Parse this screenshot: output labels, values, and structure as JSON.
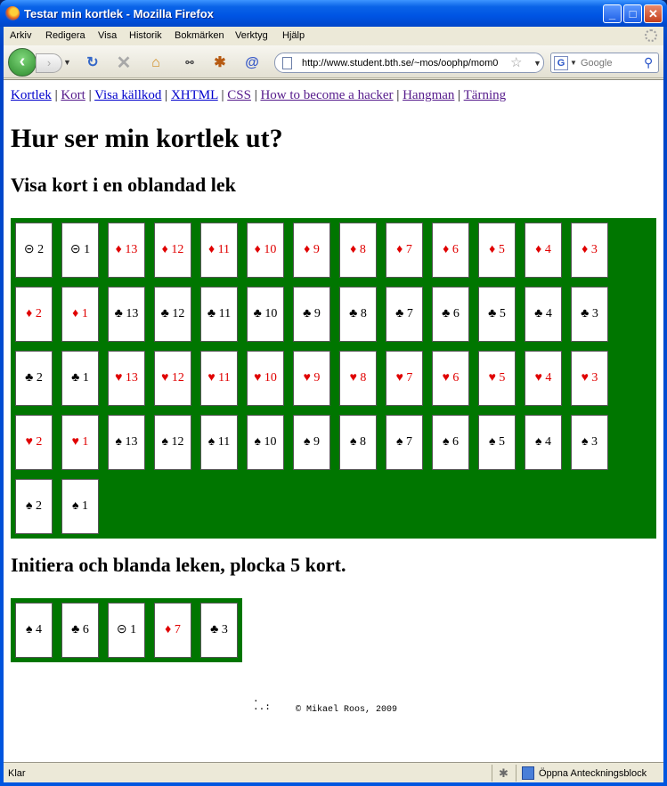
{
  "window": {
    "title": "Testar min kortlek - Mozilla Firefox"
  },
  "menubar": {
    "items": [
      "Arkiv",
      "Redigera",
      "Visa",
      "Historik",
      "Bokmärken",
      "Verktyg",
      "Hjälp"
    ]
  },
  "navbar": {
    "url": "http://www.student.bth.se/~mos/oophp/mom0",
    "search_placeholder": "Google",
    "search_engine_letter": "G"
  },
  "page": {
    "top_links": [
      "Kortlek",
      "Kort",
      "Visa källkod",
      "XHTML",
      "CSS",
      "How to become a hacker",
      "Hangman",
      "Tärning"
    ],
    "link_separator": "|",
    "heading": "Hur ser min kortlek ut?",
    "section1_heading": "Visa kort i en oblandad lek",
    "section2_heading": "Initiera och blanda leken, plocka 5 kort.",
    "colors": {
      "table_green": "#007600",
      "red_suit": "#e00000",
      "black_suit": "#000000"
    },
    "unshuffled_cards": [
      {
        "suit": "⊝",
        "value": "2",
        "color": "black"
      },
      {
        "suit": "⊝",
        "value": "1",
        "color": "black"
      },
      {
        "suit": "♦",
        "value": "13",
        "color": "red"
      },
      {
        "suit": "♦",
        "value": "12",
        "color": "red"
      },
      {
        "suit": "♦",
        "value": "11",
        "color": "red"
      },
      {
        "suit": "♦",
        "value": "10",
        "color": "red"
      },
      {
        "suit": "♦",
        "value": "9",
        "color": "red"
      },
      {
        "suit": "♦",
        "value": "8",
        "color": "red"
      },
      {
        "suit": "♦",
        "value": "7",
        "color": "red"
      },
      {
        "suit": "♦",
        "value": "6",
        "color": "red"
      },
      {
        "suit": "♦",
        "value": "5",
        "color": "red"
      },
      {
        "suit": "♦",
        "value": "4",
        "color": "red"
      },
      {
        "suit": "♦",
        "value": "3",
        "color": "red"
      },
      {
        "suit": "♦",
        "value": "2",
        "color": "red"
      },
      {
        "suit": "♦",
        "value": "1",
        "color": "red"
      },
      {
        "suit": "♣",
        "value": "13",
        "color": "black"
      },
      {
        "suit": "♣",
        "value": "12",
        "color": "black"
      },
      {
        "suit": "♣",
        "value": "11",
        "color": "black"
      },
      {
        "suit": "♣",
        "value": "10",
        "color": "black"
      },
      {
        "suit": "♣",
        "value": "9",
        "color": "black"
      },
      {
        "suit": "♣",
        "value": "8",
        "color": "black"
      },
      {
        "suit": "♣",
        "value": "7",
        "color": "black"
      },
      {
        "suit": "♣",
        "value": "6",
        "color": "black"
      },
      {
        "suit": "♣",
        "value": "5",
        "color": "black"
      },
      {
        "suit": "♣",
        "value": "4",
        "color": "black"
      },
      {
        "suit": "♣",
        "value": "3",
        "color": "black"
      },
      {
        "suit": "♣",
        "value": "2",
        "color": "black"
      },
      {
        "suit": "♣",
        "value": "1",
        "color": "black"
      },
      {
        "suit": "♥",
        "value": "13",
        "color": "red"
      },
      {
        "suit": "♥",
        "value": "12",
        "color": "red"
      },
      {
        "suit": "♥",
        "value": "11",
        "color": "red"
      },
      {
        "suit": "♥",
        "value": "10",
        "color": "red"
      },
      {
        "suit": "♥",
        "value": "9",
        "color": "red"
      },
      {
        "suit": "♥",
        "value": "8",
        "color": "red"
      },
      {
        "suit": "♥",
        "value": "7",
        "color": "red"
      },
      {
        "suit": "♥",
        "value": "6",
        "color": "red"
      },
      {
        "suit": "♥",
        "value": "5",
        "color": "red"
      },
      {
        "suit": "♥",
        "value": "4",
        "color": "red"
      },
      {
        "suit": "♥",
        "value": "3",
        "color": "red"
      },
      {
        "suit": "♥",
        "value": "2",
        "color": "red"
      },
      {
        "suit": "♥",
        "value": "1",
        "color": "red"
      },
      {
        "suit": "♠",
        "value": "13",
        "color": "black"
      },
      {
        "suit": "♠",
        "value": "12",
        "color": "black"
      },
      {
        "suit": "♠",
        "value": "11",
        "color": "black"
      },
      {
        "suit": "♠",
        "value": "10",
        "color": "black"
      },
      {
        "suit": "♠",
        "value": "9",
        "color": "black"
      },
      {
        "suit": "♠",
        "value": "8",
        "color": "black"
      },
      {
        "suit": "♠",
        "value": "7",
        "color": "black"
      },
      {
        "suit": "♠",
        "value": "6",
        "color": "black"
      },
      {
        "suit": "♠",
        "value": "5",
        "color": "black"
      },
      {
        "suit": "♠",
        "value": "4",
        "color": "black"
      },
      {
        "suit": "♠",
        "value": "3",
        "color": "black"
      },
      {
        "suit": "♠",
        "value": "2",
        "color": "black"
      },
      {
        "suit": "♠",
        "value": "1",
        "color": "black"
      }
    ],
    "hand_cards": [
      {
        "suit": "♠",
        "value": "4",
        "color": "black"
      },
      {
        "suit": "♣",
        "value": "6",
        "color": "black"
      },
      {
        "suit": "⊝",
        "value": "1",
        "color": "black"
      },
      {
        "suit": "♦",
        "value": "7",
        "color": "red"
      },
      {
        "suit": "♣",
        "value": "3",
        "color": "black"
      }
    ],
    "footer_logo": ".\n..:",
    "footer_text": "© Mikael Roos, 2009"
  },
  "statusbar": {
    "status": "Klar",
    "notepad_label": "Öppna Anteckningsblock"
  }
}
